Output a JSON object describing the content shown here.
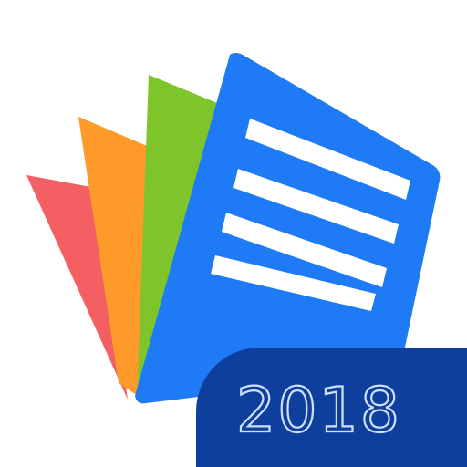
{
  "app_icon": {
    "badge": {
      "year": "2018"
    },
    "pages": [
      {
        "name": "red-page",
        "color": "#f35f63"
      },
      {
        "name": "orange-page",
        "color": "#fd9a2a"
      },
      {
        "name": "green-page",
        "color": "#7dc52a"
      },
      {
        "name": "blue-document",
        "color": "#1e7bf5"
      }
    ],
    "document_lines": 4,
    "colors": {
      "badge": "#0f3f9c",
      "badge_text": "#cfe0ff",
      "lines": "#ffffff"
    }
  }
}
